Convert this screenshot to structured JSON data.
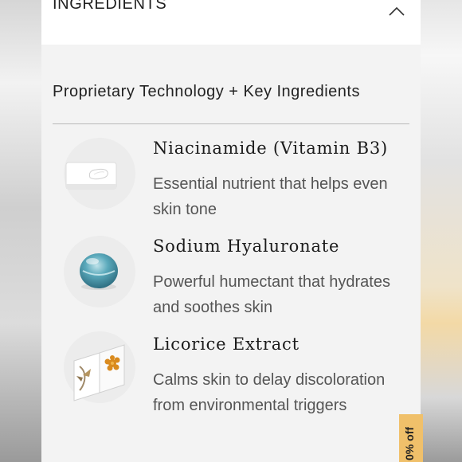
{
  "accordion": {
    "title": "INGREDIENTS",
    "toggle_icon": "chevron-up-icon"
  },
  "section": {
    "heading": "Proprietary Technology + Key Ingredients"
  },
  "ingredients": [
    {
      "name": "Niacinamide (Vitamin B3)",
      "description": "Essential nutrient that helps even skin tone",
      "icon": "cream-swatch-icon"
    },
    {
      "name": "Sodium Hyaluronate",
      "description": "Powerful humectant that hydrates and soothes skin",
      "icon": "water-droplet-icon"
    },
    {
      "name": "Licorice Extract",
      "description": "Calms skin to delay discoloration from environmental triggers",
      "icon": "botanical-cards-icon"
    }
  ],
  "promo": {
    "label": "0% off",
    "color": "#f0c06a"
  }
}
